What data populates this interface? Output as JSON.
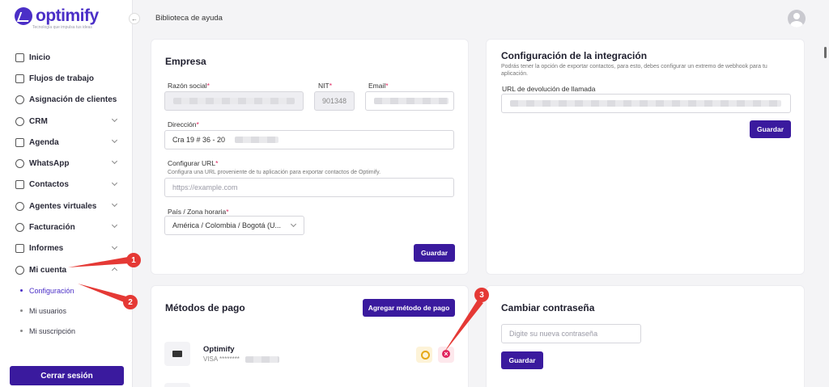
{
  "brand": {
    "name": "optimify",
    "tagline": "Tecnología que impulsa tus ideas",
    "accent": "#4b2fc7",
    "button": "#3a1a9e"
  },
  "header": {
    "breadcrumb": "Biblioteca de ayuda",
    "collapse_glyph": "←"
  },
  "sidebar": {
    "items": [
      {
        "label": "Inicio",
        "icon": "home-icon"
      },
      {
        "label": "Flujos de trabajo",
        "icon": "workflow-icon"
      },
      {
        "label": "Asignación de clientes",
        "icon": "user-assign-icon"
      },
      {
        "label": "CRM",
        "icon": "crm-icon"
      },
      {
        "label": "Agenda",
        "icon": "calendar-icon"
      },
      {
        "label": "WhatsApp",
        "icon": "whatsapp-icon"
      },
      {
        "label": "Contactos",
        "icon": "contacts-icon"
      },
      {
        "label": "Agentes virtuales",
        "icon": "bot-icon"
      },
      {
        "label": "Facturación",
        "icon": "billing-icon"
      },
      {
        "label": "Informes",
        "icon": "reports-icon"
      },
      {
        "label": "Mi cuenta",
        "icon": "user-icon"
      }
    ],
    "subitems": [
      {
        "label": "Configuración"
      },
      {
        "label": "Mi usuarios"
      },
      {
        "label": "Mi suscripción"
      }
    ],
    "logout_label": "Cerrar sesión"
  },
  "empresa": {
    "title": "Empresa",
    "razon_label": "Razón social",
    "nit_label": "NIT",
    "nit_value": "901348",
    "email_label": "Email",
    "direccion_label": "Dirección",
    "direccion_value": "Cra 19 # 36 - 20",
    "url_label": "Configurar URL",
    "url_hint": "Configura una URL proveniente de tu aplicación para exportar contactos de Optimify.",
    "url_placeholder": "https://example.com",
    "pais_label": "País / Zona horaria",
    "pais_value": "América / Colombia / Bogotá (U...",
    "req": "*",
    "save_label": "Guardar"
  },
  "integracion": {
    "title": "Configuración de la integración",
    "hint": "Podrás tener la opción de exportar contactos, para esto, debes configurar un extremo de webhook para tu aplicación.",
    "callback_label": "URL de devolución de llamada",
    "save_label": "Guardar"
  },
  "pagos": {
    "title": "Métodos de pago",
    "add_label": "Agregar método de pago",
    "card_name": "Optimify",
    "card_number": "VISA ********"
  },
  "password": {
    "title": "Cambiar contraseña",
    "placeholder": "Digite su nueva contraseña",
    "save_label": "Guardar"
  },
  "annotations": {
    "one": "1",
    "two": "2",
    "three": "3"
  }
}
